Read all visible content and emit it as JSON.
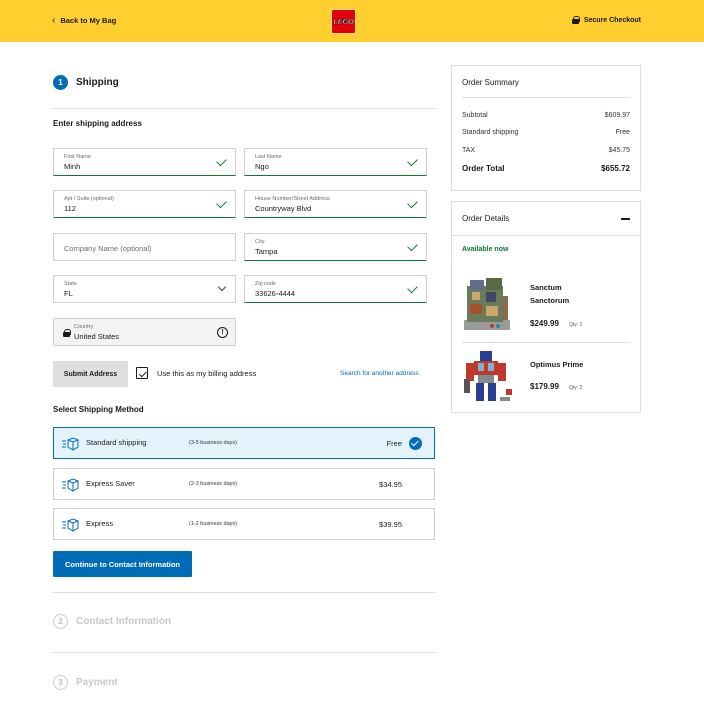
{
  "header": {
    "back_label": "Back to My Bag",
    "logo_text": "LEGO",
    "secure_label": "Secure Checkout"
  },
  "steps": {
    "shipping": {
      "number": "1",
      "title": "Shipping"
    },
    "contact": {
      "number": "2",
      "title": "Contact Information"
    },
    "payment": {
      "number": "3",
      "title": "Payment"
    }
  },
  "address_form": {
    "title": "Enter shipping address",
    "first_name": {
      "label": "First Name",
      "value": "Minh"
    },
    "last_name": {
      "label": "Last Name",
      "value": "Ngo"
    },
    "apt": {
      "label": "Apt / Suite (optional)",
      "value": "112"
    },
    "street": {
      "label": "House Number/Street Address",
      "value": "Countryway Blvd"
    },
    "company": {
      "placeholder": "Company Name (optional)"
    },
    "city": {
      "label": "City",
      "value": "Tampa"
    },
    "state": {
      "label": "State",
      "value": "FL"
    },
    "zip": {
      "label": "Zip code",
      "value": "33626-4444"
    },
    "country": {
      "label": "Country",
      "value": "United States"
    },
    "submit_label": "Submit Address",
    "billing_label": "Use this as my billing address",
    "billing_checked": true,
    "search_another_label": "Search for another address"
  },
  "shipping_method": {
    "title": "Select Shipping Method",
    "options": [
      {
        "name": "Standard shipping",
        "days": "(3-5 business days)",
        "price": "Free",
        "selected": true
      },
      {
        "name": "Express Saver",
        "days": "(2-3 business days)",
        "price": "$34.95",
        "selected": false
      },
      {
        "name": "Express",
        "days": "(1-2 business days)",
        "price": "$39.95",
        "selected": false
      }
    ],
    "continue_label": "Continue to Contact Information"
  },
  "order_summary": {
    "title": "Order Summary",
    "rows": [
      {
        "label": "Subtotal",
        "value": "$609.97"
      },
      {
        "label": "Standard shipping",
        "value": "Free"
      },
      {
        "label": "TAX",
        "value": "$45.75"
      }
    ],
    "total": {
      "label": "Order Total",
      "value": "$655.72"
    }
  },
  "order_details": {
    "title": "Order Details",
    "availability": "Available now",
    "items": [
      {
        "name_line1": "Sanctum",
        "name_line2": "Sanctorum",
        "price": "$249.99",
        "qty": "Qty: 1"
      },
      {
        "name_line1": "Optimus Prime",
        "price": "$179.99",
        "qty": "Qty: 2"
      }
    ]
  },
  "colors": {
    "header_yellow": "#ffcf2f",
    "brand_blue": "#006cb7",
    "valid_green": "#0a7a33",
    "lego_red": "#e3000b"
  },
  "icons": [
    "chevron-left-icon",
    "lock-icon",
    "checkmark-icon",
    "chevron-down-icon",
    "info-icon",
    "delivery-box-icon",
    "minus-icon"
  ]
}
